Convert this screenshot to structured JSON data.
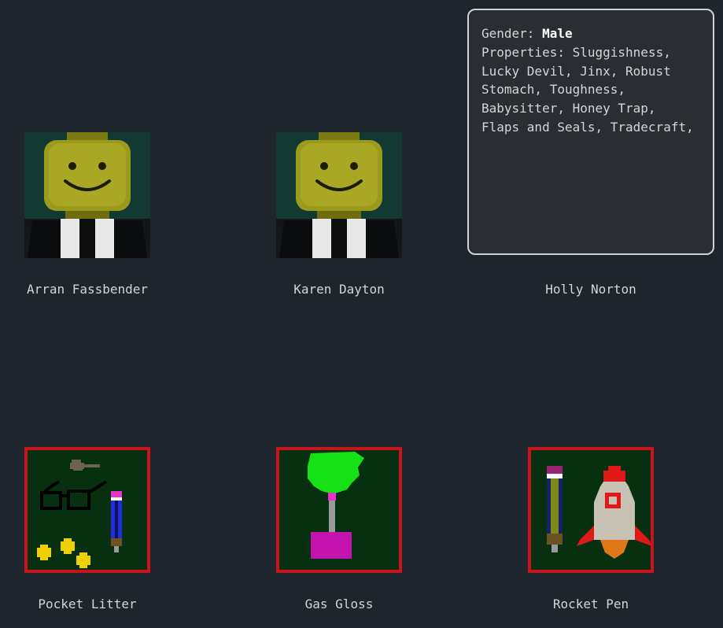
{
  "characters": [
    {
      "name": "Arran Fassbender",
      "icon": "lego-minifig-portrait-icon"
    },
    {
      "name": "Karen Dayton",
      "icon": "lego-minifig-portrait-icon"
    },
    {
      "name": "Holly Norton",
      "icon": "lego-minifig-portrait-icon"
    }
  ],
  "tooltip": {
    "gender_label": "Gender:",
    "gender_value": "Male",
    "properties_label": "Properties:",
    "properties_value": "Sluggishness, Lucky Devil, Jinx, Robust Stomach, Toughness, Babysitter, Honey Trap, Flaps and Seals, Tradecraft,"
  },
  "items": [
    {
      "name": "Pocket Litter",
      "icon": "glasses-key-pencil-coins-icon"
    },
    {
      "name": "Gas Gloss",
      "icon": "gas-gloss-plant-icon"
    },
    {
      "name": "Rocket Pen",
      "icon": "rocket-pen-icon"
    }
  ],
  "colors": {
    "background": "#1f252c",
    "item_border": "#c8141a",
    "item_background": "#063010",
    "tooltip_border": "#cfd2d6"
  }
}
